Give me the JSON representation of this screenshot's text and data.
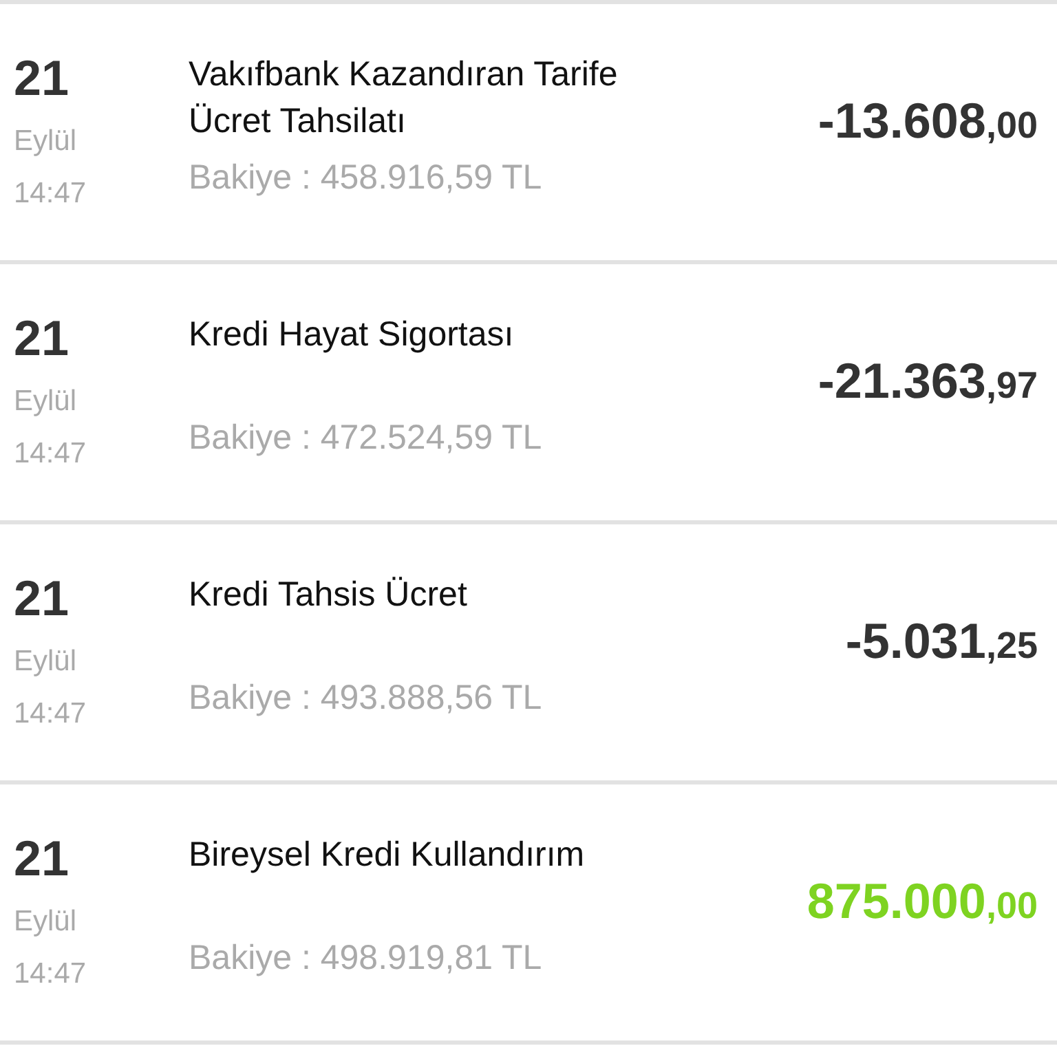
{
  "transactions": [
    {
      "day": "21",
      "month": "Eylül",
      "time": "14:47",
      "title": "Vakıfbank Kazandıran Tarife Ücret Tahsilatı",
      "balance": "Bakiye : 458.916,59 TL",
      "amount": "-13.608",
      "amount_decimals": ",00",
      "kind": "debit"
    },
    {
      "day": "21",
      "month": "Eylül",
      "time": "14:47",
      "title": "Kredi Hayat Sigortası",
      "balance": "Bakiye : 472.524,59 TL",
      "amount": "-21.363",
      "amount_decimals": ",97",
      "kind": "debit"
    },
    {
      "day": "21",
      "month": "Eylül",
      "time": "14:47",
      "title": "Kredi Tahsis Ücret",
      "balance": "Bakiye : 493.888,56 TL",
      "amount": "-5.031",
      "amount_decimals": ",25",
      "kind": "debit"
    },
    {
      "day": "21",
      "month": "Eylül",
      "time": "14:47",
      "title": "Bireysel Kredi Kullandırım",
      "balance": "Bakiye : 498.919,81 TL",
      "amount": "875.000",
      "amount_decimals": ",00",
      "kind": "credit"
    }
  ]
}
